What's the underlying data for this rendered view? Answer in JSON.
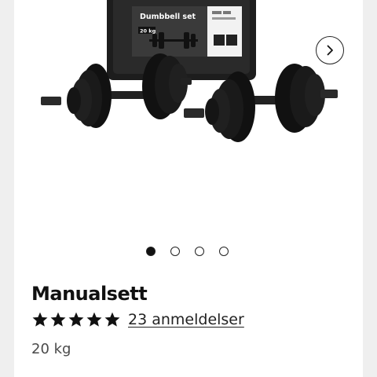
{
  "product": {
    "name": "Manualsett",
    "rating_stars": 5,
    "rating_max": 5,
    "reviews_text": "23 anmeldelser",
    "variant": "20 kg"
  },
  "gallery": {
    "image_count": 4,
    "active_index": 0,
    "next_icon": "chevron-right-icon"
  },
  "box_label": {
    "title": "Dumbbell set",
    "weight": "20 kg"
  },
  "colors": {
    "page_bg": "#efefef",
    "card_bg": "#ffffff",
    "text": "#1a1a1a",
    "muted": "#4a4a4a"
  }
}
